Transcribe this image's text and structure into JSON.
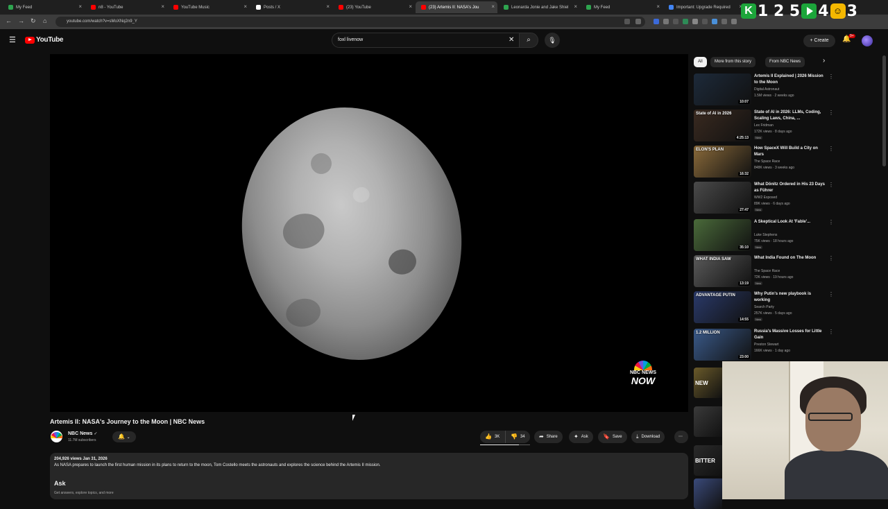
{
  "browser": {
    "tabs": [
      {
        "title": "My Feed",
        "color": "#2ea44f"
      },
      {
        "title": "n8 - YouTube",
        "color": "#ff0000"
      },
      {
        "title": "YouTube Music",
        "color": "#ff0000"
      },
      {
        "title": "Posts / X",
        "color": "#ffffff"
      },
      {
        "title": "(23) YouTube",
        "color": "#ff0000"
      },
      {
        "title": "(23) Artemis II: NASA's Jou",
        "color": "#ff0000"
      },
      {
        "title": "Leonarda Jonie and Jake Shiel",
        "color": "#2ea44f"
      },
      {
        "title": "My Feed",
        "color": "#2ea44f"
      },
      {
        "title": "Important: Upgrade Required",
        "color": "#4285f4"
      }
    ],
    "url": "youtube.com/watch?v=sMoXNq2n9_Y"
  },
  "overlay": {
    "k_label": "K",
    "num_a": "1 2 5",
    "num_b": "4",
    "num_c": "3",
    "face": "☺"
  },
  "youtube": {
    "logo_text": "YouTube",
    "search_value": "foxl livenow",
    "create_label": "Create",
    "notif_badge": "9+"
  },
  "player": {
    "watermark_line1": "NBC NEWS",
    "watermark_line2": "NOW"
  },
  "video": {
    "title": "Artemis II: NASA's Journey to the Moon | NBC News",
    "channel": "NBC News",
    "subscribers": "11.7M subscribers",
    "likes": "3K",
    "dislikes": "34",
    "like_ratio": 0.78,
    "share_label": "Share",
    "ask_label": "Ask",
    "save_label": "Save",
    "download_label": "Download",
    "description_meta": "204,926 views  Jan 31, 2026",
    "description_text": "As NASA prepares to launch the first human mission in its plans to return to the moon, Tom Costello meets the astronauts and explores the science behind the Artemis II mission.",
    "ask_heading": "Ask",
    "ask_desc": "Get answers, explore topics, and more"
  },
  "sidebar": {
    "chips": [
      "All",
      "More from this story",
      "From NBC News"
    ],
    "recommendations": [
      {
        "title": "Artemis II Explained | 2026 Mission to the Moon",
        "channel": "Digital Astronaut",
        "meta": "1.5M views · 2 weeks ago",
        "duration": "10:07",
        "thumb_text": "",
        "thumb_color": "#1d2a3a",
        "new": ""
      },
      {
        "title": "State of AI in 2026: LLMs, Coding, Scaling Laws, China, ...",
        "channel": "Lex Fridman",
        "meta": "172K views · 8 days ago",
        "duration": "4:25:13",
        "thumb_text": "State of AI in 2026",
        "thumb_color": "#3a2a20",
        "new": "New"
      },
      {
        "title": "How SpaceX Will Build a City on Mars",
        "channel": "The Space Race",
        "meta": "848K views · 3 weeks ago",
        "duration": "16:32",
        "thumb_text": "ELON'S PLAN",
        "thumb_color": "#8a6a3a",
        "new": ""
      },
      {
        "title": "What Dönitz Ordered in His 23 Days as Führer",
        "channel": "WW2 Exposed",
        "meta": "89K views · 6 days ago",
        "duration": "27:47",
        "thumb_text": "",
        "thumb_color": "#4a4a4a",
        "new": "New"
      },
      {
        "title": "A Skeptical Look At 'Fable'...",
        "channel": "Luke Stephens",
        "meta": "75K views · 18 hours ago",
        "duration": "35:10",
        "thumb_text": "",
        "thumb_color": "#4a6a3a",
        "new": "New"
      },
      {
        "title": "What India Found on The Moon",
        "channel": "The Space Race",
        "meta": "72K views · 19 hours ago",
        "duration": "13:19",
        "thumb_text": "WHAT INDIA SAW",
        "thumb_color": "#5a5a5a",
        "new": "New"
      },
      {
        "title": "Why Putin's new playbook is working",
        "channel": "Search Party",
        "meta": "257K views · 5 days ago",
        "duration": "14:55",
        "thumb_text": "ADVANTAGE PUTIN",
        "thumb_color": "#2a3a6a",
        "new": "New"
      },
      {
        "title": "Russia's Massive Losses for Little Gain",
        "channel": "Preston Stewart",
        "meta": "166K views · 1 day ago",
        "duration": "23:00",
        "thumb_text": "1.2 MILLION",
        "thumb_color": "#3a5a8a",
        "new": ""
      }
    ],
    "partial_thumbs": [
      {
        "text": "NEW",
        "color": "#6a5a2a"
      },
      {
        "text": "",
        "color": "#3a3a3a"
      },
      {
        "text": "BITTER",
        "color": "#2a2a2a"
      },
      {
        "text": "",
        "color": "#3a4a7a"
      }
    ]
  }
}
